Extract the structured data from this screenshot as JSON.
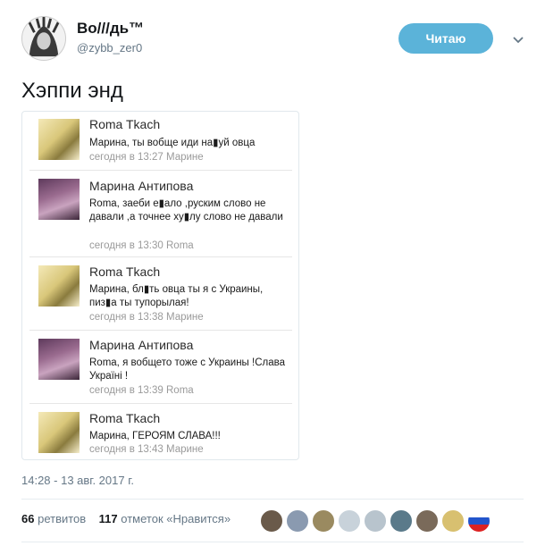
{
  "author": {
    "display_name": "Во///дь™",
    "handle": "@zybb_zer0",
    "follow_label": "Читаю"
  },
  "tweet": {
    "text": "Хэппи энд"
  },
  "comments": [
    {
      "name": "Roma Tkach",
      "text": "Марина, ты вобще иди на▮уй овца",
      "meta": "сегодня в 13:27 Марине"
    },
    {
      "name": "Марина Антипова",
      "text": "Roma, заеби е▮ало ,руским слово не давали ,а точнее ху▮лу слово не давали",
      "meta": "сегодня в 13:30 Roma"
    },
    {
      "name": "Roma Tkach",
      "text": "Марина, бл▮ть овца ты я с Украины, пиз▮а ты тупорылая!",
      "meta": "сегодня в 13:38 Марине"
    },
    {
      "name": "Марина Антипова",
      "text": "Roma, я вобщето тоже с Украины !Слава Україні !",
      "meta": "сегодня в 13:39 Roma"
    },
    {
      "name": "Roma Tkach",
      "text": "Марина, ГЕРОЯМ СЛАВА!!!",
      "meta": "сегодня в 13:43 Марине"
    }
  ],
  "footer": {
    "timestamp": "14:28 - 13 авг. 2017 г.",
    "retweets_count": "66",
    "retweets_label": "ретвитов",
    "likes_count": "117",
    "likes_label": "отметок «Нравится»"
  },
  "colors": {
    "accent": "#5bb3d9",
    "muted": "#657786"
  }
}
